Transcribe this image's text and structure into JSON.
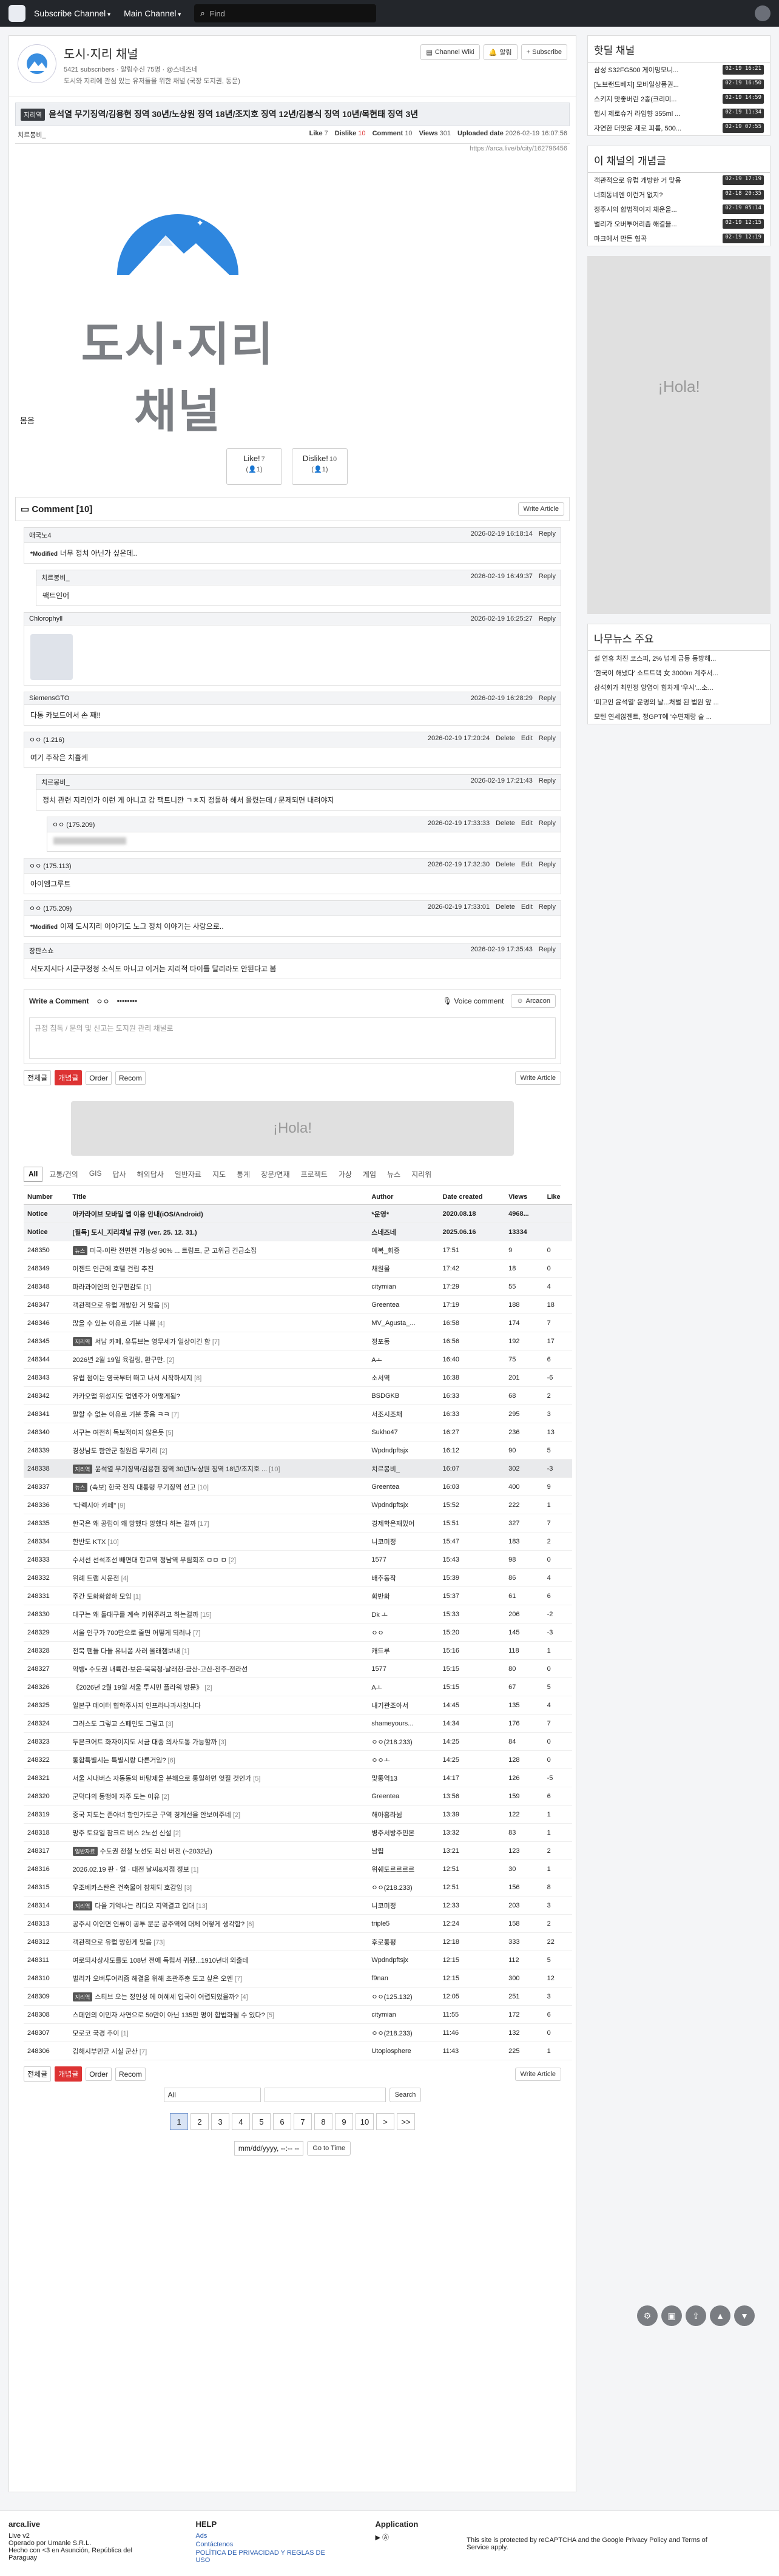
{
  "nav": {
    "subscribe": "Subscribe Channel",
    "main": "Main Channel",
    "search_placeholder": "Find"
  },
  "channel": {
    "name": "도시·지리 채널",
    "subs": "5421 subscribers",
    "alarm": "알림수신 75명",
    "owner": "@스네즈네",
    "desc": "도시와 지리에 관심 있는 유저들을 위한 채널 (국장 도지권, 동문)",
    "wiki": "Channel Wiki",
    "alarm_btn": "알림",
    "subscribe_btn": "+ Subscribe"
  },
  "article": {
    "tag": "지리역",
    "title": "윤석열 무기징역/김용현 징역 30년/노상원 징역 18년/조지호 징역 12년/김봉식 징역 10년/목현태 징역 3년",
    "author": "치르봉비_",
    "like": "7",
    "dislike": "10",
    "comment": "10",
    "views": "301",
    "uploaded": "2026-02-19 16:07:56",
    "url": "https://arca.live/b/city/162796456",
    "body_brand": "도시·지리 채널",
    "body_text": "몸음",
    "like_btn": "Like!",
    "like_n": "7",
    "like_u": "(👤1)",
    "dislike_btn": "Dislike!",
    "dislike_n": "10",
    "dislike_u": "(👤1)"
  },
  "labels": {
    "like": "Like",
    "dislike": "Dislike",
    "comment": "Comment",
    "views": "Views",
    "uploaded": "Uploaded date",
    "comment_title": "Comment [10]",
    "write_article": "Write Article",
    "reply": "Reply",
    "delete": "Delete",
    "edit": "Edit",
    "write_comment": "Write a Comment",
    "pw_dots": "••••••••",
    "voice": "Voice comment",
    "arcacon": "Arcacon",
    "textarea": "규정 침독 / 문의 및 신고는 도지원 관리 채널로",
    "all_list": "전체글",
    "hot": "개념글",
    "order": "Order",
    "recom": "Recom",
    "modified": "*Modified",
    "ad": "¡Hola!"
  },
  "comments": [
    {
      "name": "애국노4",
      "date": "2026-02-19 16:18:14",
      "text": "너무 정치 아닌가 싶은데..",
      "mod": true,
      "indent": 0,
      "own": false
    },
    {
      "name": "치르봉비_",
      "date": "2026-02-19 16:49:37",
      "text": "팩트인어",
      "mod": false,
      "indent": 1,
      "own": false
    },
    {
      "name": "Chlorophyll",
      "date": "2026-02-19 16:25:27",
      "text": "",
      "mod": false,
      "indent": 0,
      "own": false,
      "avatar": true
    },
    {
      "name": "SiemensGTO",
      "date": "2026-02-19 16:28:29",
      "text": "다통 카보드에서 손 째!!",
      "mod": false,
      "indent": 0,
      "own": false
    },
    {
      "name": "ㅇㅇ (1.216)",
      "date": "2026-02-19 17:20:24",
      "text": "여기 주작은 치흘케",
      "mod": false,
      "indent": 0,
      "own": true
    },
    {
      "name": "치르봉비_",
      "date": "2026-02-19 17:21:43",
      "text": "정치 관련 지리인가 이런 게 아니고 감 팩트니깐 ㄱㅊ지 정몰하 해서 올렸는데 / 문제되면 내려야지",
      "mod": false,
      "indent": 1,
      "own": false
    },
    {
      "name": "ㅇㅇ (175.209)",
      "date": "2026-02-19 17:33:33",
      "text": "",
      "mod": false,
      "indent": 2,
      "own": true,
      "blur": true
    },
    {
      "name": "ㅇㅇ (175.113)",
      "date": "2026-02-19 17:32:30",
      "text": "아이엠그루트",
      "mod": false,
      "indent": 0,
      "own": true
    },
    {
      "name": "ㅇㅇ (175.209)",
      "date": "2026-02-19 17:33:01",
      "text": "이제 도시지리 이야기도 노그 정치 이야기는 사랑으로..",
      "mod": true,
      "indent": 0,
      "own": true
    },
    {
      "name": "장판스쇼",
      "date": "2026-02-19 17:35:43",
      "text": "서도지시다 시군구정청 소식도 아니고 이거는 지리적 타이틀 달리라도 안된다고 봄",
      "mod": false,
      "indent": 0,
      "own": false
    }
  ],
  "comment_user": "ㅇㅇ",
  "categories": [
    "All",
    "교통/건의",
    "GIS",
    "답사",
    "해외답사",
    "일반자료",
    "지도",
    "통계",
    "장문/연재",
    "프로젝트",
    "가상",
    "게임",
    "뉴스",
    "지리위"
  ],
  "table_headers": {
    "no": "Number",
    "title": "Title",
    "author": "Author",
    "date": "Date created",
    "views": "Views",
    "like": "Like"
  },
  "posts": [
    {
      "no": "Notice",
      "tag": "",
      "title": "아카라이브 모바일 앱 이용 안내(iOS/Android)",
      "cc": "",
      "author": "*운영*",
      "date": "2020.08.18",
      "views": "4968...",
      "like": "",
      "type": "notice"
    },
    {
      "no": "Notice",
      "tag": "",
      "title": "[필독] 도시_지리채널 규정 (ver. 25. 12. 31.)",
      "cc": "",
      "author": "스네즈네",
      "date": "2025.06.16",
      "views": "13334",
      "like": "",
      "type": "notice"
    },
    {
      "no": "248350",
      "tag": "뉴스",
      "title": "미국-이란 전면전 가능성 90% ... 트럼프, 군 고위급 긴급소집",
      "cc": "",
      "author": "예복_회증",
      "date": "17:51",
      "views": "9",
      "like": "0"
    },
    {
      "no": "248349",
      "tag": "",
      "title": "이젠드 인근에 호텔 건립 추진",
      "cc": "",
      "author": "채원물",
      "date": "17:42",
      "views": "18",
      "like": "0"
    },
    {
      "no": "248348",
      "tag": "",
      "title": "파라과이인의 인구편감도",
      "cc": "[1]",
      "author": "citymian",
      "date": "17:29",
      "views": "55",
      "like": "4"
    },
    {
      "no": "248347",
      "tag": "",
      "title": "객관적으로 유럽 개방한 거 맞음",
      "cc": "[5]",
      "author": "Greentea",
      "date": "17:19",
      "views": "188",
      "like": "18"
    },
    {
      "no": "248346",
      "tag": "",
      "title": "많을 수 있는 이유로 기분 나쁨",
      "cc": "[4]",
      "author": "MV_Agusta_...",
      "date": "16:58",
      "views": "174",
      "like": "7"
    },
    {
      "no": "248345",
      "tag": "지리역",
      "title": "서남 카페, 유튜브는 영무세가 일상이긴 함",
      "cc": "[7]",
      "author": "정포동",
      "date": "16:56",
      "views": "192",
      "like": "17"
    },
    {
      "no": "248344",
      "tag": "",
      "title": "2026년 2월 19일 육길링, 환구만.",
      "cc": "[2]",
      "author": "Aㅗ",
      "date": "16:40",
      "views": "75",
      "like": "6"
    },
    {
      "no": "248343",
      "tag": "",
      "title": "유럽 점이는 영국부터 떠고 나서 시작하시지",
      "cc": "[8]",
      "author": "소서역",
      "date": "16:38",
      "views": "201",
      "like": "-6"
    },
    {
      "no": "248342",
      "tag": "",
      "title": "카카오맵 위성지도 업엔주가 어떻게됨?",
      "cc": "",
      "author": "BSDGKB",
      "date": "16:33",
      "views": "68",
      "like": "2"
    },
    {
      "no": "248341",
      "tag": "",
      "title": "말할 수 없는 이유로 기분 좋음 ㅋㅋ",
      "cc": "[7]",
      "author": "서조시조채",
      "date": "16:33",
      "views": "295",
      "like": "3"
    },
    {
      "no": "248340",
      "tag": "",
      "title": "서구는 여전히 독보적이지 않은듯",
      "cc": "[5]",
      "author": "Sukho47",
      "date": "16:27",
      "views": "236",
      "like": "13"
    },
    {
      "no": "248339",
      "tag": "",
      "title": "경상남도 함안군 칠원읍 무기리",
      "cc": "[2]",
      "author": "Wpdndpftsjx",
      "date": "16:12",
      "views": "90",
      "like": "5"
    },
    {
      "no": "248338",
      "tag": "지리역",
      "title": "윤석열 무기징역/김용현 징역 30년/노상원 징역 18년/조지호 ...",
      "cc": "[10]",
      "author": "치르봉비_",
      "date": "16:07",
      "views": "302",
      "like": "-3",
      "type": "cur"
    },
    {
      "no": "248337",
      "tag": "뉴스",
      "title": "(속보) 한국 전직 대통령 무기징역 선고",
      "cc": "[10]",
      "author": "Greentea",
      "date": "16:03",
      "views": "400",
      "like": "9"
    },
    {
      "no": "248336",
      "tag": "",
      "title": "\"다렉시아 카페\"",
      "cc": "[9]",
      "author": "Wpdndpftsjx",
      "date": "15:52",
      "views": "222",
      "like": "1"
    },
    {
      "no": "248335",
      "tag": "",
      "title": "한국은 왜 공립이 왜 망했다 망했다 하는 걸까",
      "cc": "[17]",
      "author": "경제학은재밌어",
      "date": "15:51",
      "views": "327",
      "like": "7"
    },
    {
      "no": "248334",
      "tag": "",
      "title": "한반도 KTX",
      "cc": "[10]",
      "author": "니코미정",
      "date": "15:47",
      "views": "183",
      "like": "2"
    },
    {
      "no": "248333",
      "tag": "",
      "title": "수서선 선석조선 빼면대 한교역 정남역 무림회조 ㅁㅁ ㅁ",
      "cc": "[2]",
      "author": "1577",
      "date": "15:43",
      "views": "98",
      "like": "0"
    },
    {
      "no": "248332",
      "tag": "",
      "title": "위례 트램 시운전",
      "cc": "[4]",
      "author": "배추동작",
      "date": "15:39",
      "views": "86",
      "like": "4"
    },
    {
      "no": "248331",
      "tag": "",
      "title": "주간 도화화합하 모임",
      "cc": "[1]",
      "author": "화반화",
      "date": "15:37",
      "views": "61",
      "like": "6"
    },
    {
      "no": "248330",
      "tag": "",
      "title": "대구는 왜 돌대구를 계속 키워주려고 하는걸까",
      "cc": "[15]",
      "author": "Dk ㅗ",
      "date": "15:33",
      "views": "206",
      "like": "-2"
    },
    {
      "no": "248329",
      "tag": "",
      "title": "서울 인구가 700만으로 줄면 어떻게 되려나",
      "cc": "[7]",
      "author": "ㅇㅇ",
      "date": "15:20",
      "views": "145",
      "like": "-3"
    },
    {
      "no": "248328",
      "tag": "",
      "title": "전북 팬들 다들 유니폼 사러 올래챔보내",
      "cc": "[1]",
      "author": "캐드루",
      "date": "15:16",
      "views": "118",
      "like": "1"
    },
    {
      "no": "248327",
      "tag": "",
      "title": "약뱅• 수도권 내륙컨-보은-복복청-날래천-금산-고산-전주-전라선",
      "cc": "",
      "author": "1577",
      "date": "15:15",
      "views": "80",
      "like": "0"
    },
    {
      "no": "248326",
      "tag": "",
      "title": "《2026년 2월 19일 서울 투시민 플라워 방문》",
      "cc": "[2]",
      "author": "Aㅗ",
      "date": "15:15",
      "views": "67",
      "like": "5"
    },
    {
      "no": "248325",
      "tag": "",
      "title": "일본구 데이터 협학주사지 인프라나과사참니다",
      "cc": "",
      "author": "내기관조아서",
      "date": "14:45",
      "views": "135",
      "like": "4"
    },
    {
      "no": "248324",
      "tag": "",
      "title": "그러스도 그렇고 스페인도 그렇고",
      "cc": "[3]",
      "author": "shameyours...",
      "date": "14:34",
      "views": "176",
      "like": "7"
    },
    {
      "no": "248323",
      "tag": "",
      "title": "두븐크어트 화자이지도 서금 대중 의사도통 가능할까",
      "cc": "[3]",
      "author": "ㅇㅇ(218.233)",
      "date": "14:25",
      "views": "84",
      "like": "0"
    },
    {
      "no": "248322",
      "tag": "",
      "title": "통합특별시는 특별시랑 다른거임?",
      "cc": "[6]",
      "author": "ㅇㅇㅗ",
      "date": "14:25",
      "views": "128",
      "like": "0"
    },
    {
      "no": "248321",
      "tag": "",
      "title": "서울 시내버스 자동동의 바탕제을 분해으로 통일하면 엇질 것인가",
      "cc": "[5]",
      "author": "맞통역13",
      "date": "14:17",
      "views": "126",
      "like": "-5"
    },
    {
      "no": "248320",
      "tag": "",
      "title": "군덕다의 동맹에 자주 도는 이유",
      "cc": "[2]",
      "author": "Greentea",
      "date": "13:56",
      "views": "159",
      "like": "6"
    },
    {
      "no": "248319",
      "tag": "",
      "title": "중국 지도는 존아너 항인가도군 구역 경계선을 안보여주네",
      "cc": "[2]",
      "author": "해아홍라뉨",
      "date": "13:39",
      "views": "122",
      "like": "1"
    },
    {
      "no": "248318",
      "tag": "",
      "title": "망주 토요일 참크르 버스 2노선 신설",
      "cc": "[2]",
      "author": "병주서방주민본",
      "date": "13:32",
      "views": "83",
      "like": "1"
    },
    {
      "no": "248317",
      "tag": "일반자료",
      "title": "수도권 전철 노선도 최신 버전 (~2032년)",
      "cc": "",
      "author": "남렵",
      "date": "13:21",
      "views": "123",
      "like": "2"
    },
    {
      "no": "248316",
      "tag": "",
      "title": "2026.02.19 판 · 얼 · 대전 날씨&지점 정보",
      "cc": "[1]",
      "author": "위쉐도르르르르",
      "date": "12:51",
      "views": "30",
      "like": "1"
    },
    {
      "no": "248315",
      "tag": "",
      "title": "우조베카스탄은 건축물이 참체되 호감임",
      "cc": "[3]",
      "author": "ㅇㅇ(218.233)",
      "date": "12:51",
      "views": "156",
      "like": "8"
    },
    {
      "no": "248314",
      "tag": "지리역",
      "title": "다을 기억나는 리디오 지역결고 입대",
      "cc": "[13]",
      "author": "니코미정",
      "date": "12:33",
      "views": "203",
      "like": "3"
    },
    {
      "no": "248313",
      "tag": "",
      "title": "공주시 이인면 인류이 공투 분문 공주역에 대체 어떻게 생각함?",
      "cc": "[6]",
      "author": "triple5",
      "date": "12:24",
      "views": "158",
      "like": "2"
    },
    {
      "no": "248312",
      "tag": "",
      "title": "객관적으로 유럽 망한게 맞음",
      "cc": "[73]",
      "author": "후로통평",
      "date": "12:18",
      "views": "333",
      "like": "22"
    },
    {
      "no": "248311",
      "tag": "",
      "title": "여로되사상사도를도 108년 전에 독립서 귀됐...1910년대 외출테",
      "cc": "",
      "author": "Wpdndpftsjx",
      "date": "12:15",
      "views": "112",
      "like": "5"
    },
    {
      "no": "248310",
      "tag": "",
      "title": "벌리가 오버투어리즘 해결을 위해 초관주충 도고 싶은 오엔",
      "cc": "[7]",
      "author": "f9nan",
      "date": "12:15",
      "views": "300",
      "like": "12"
    },
    {
      "no": "248309",
      "tag": "지리역",
      "title": "스티브 오는 정인성 에 여혜세 입국이 어렵되었을까?",
      "cc": "[4]",
      "author": "ㅇㅇ(125.132)",
      "date": "12:05",
      "views": "251",
      "like": "3"
    },
    {
      "no": "248308",
      "tag": "",
      "title": "스페인의 이민자 사연으로 50만이 아닌 135만 명이 합법화될 수 있다?",
      "cc": "[5]",
      "author": "citymian",
      "date": "11:55",
      "views": "172",
      "like": "6"
    },
    {
      "no": "248307",
      "tag": "",
      "title": "모로코 국경 추이",
      "cc": "[1]",
      "author": "ㅇㅇ(218.233)",
      "date": "11:46",
      "views": "132",
      "like": "0"
    },
    {
      "no": "248306",
      "tag": "",
      "title": "김해시부민균 시실 군산",
      "cc": "[7]",
      "author": "Utopiosphere",
      "date": "11:43",
      "views": "225",
      "like": "1"
    }
  ],
  "pager": [
    "1",
    "2",
    "3",
    "4",
    "5",
    "6",
    "7",
    "8",
    "9",
    "10",
    ">",
    ">>"
  ],
  "search": {
    "scope": "All",
    "btn": "Search",
    "date_placeholder": "mm/dd/yyyy, --:-- --",
    "go": "Go to Time"
  },
  "footer": {
    "brand": "arca.live",
    "ver": "Live v2",
    "company": "Operado por Umanle S.R.L.",
    "made": "Hecho con <3 en Asunción, República del Paraguay",
    "help": "HELP",
    "ads": "Ads",
    "contact": "Contáctenos",
    "policy": "POLÍTICA DE PRIVACIDAD Y REGLAS DE USO",
    "app": "Application",
    "recaptcha": "This site is protected by reCAPTCHA and the Google Privacy Policy and Terms of Service apply."
  },
  "side": {
    "hot_title": "핫딜 채널",
    "hot": [
      {
        "t": "삼성 S32FG500 게이밍모니...",
        "tm": "02-19 16:21"
      },
      {
        "t": "[노브랜드베지] 모바일상품권...",
        "tm": "02-19 16:50"
      },
      {
        "t": "스키지 맛좋버린 2종(크리미...",
        "tm": "02-19 14:59"
      },
      {
        "t": "햅시 제로슈거 라임향 355ml ...",
        "tm": "02-19 11:34"
      },
      {
        "t": "자연한 더맛운 제로 피룸, 500...",
        "tm": "02-19 07:55"
      }
    ],
    "best_title": "이 채널의 개념글",
    "best": [
      {
        "t": "객관적으로 유럽 개방한 거 맞음",
        "tm": "02-19 17:19"
      },
      {
        "t": "너희동네엔 이런거 없지?",
        "tm": "02-18 20:35"
      },
      {
        "t": "정주시의 합법적이지 채운을...",
        "tm": "02-19 05:14"
      },
      {
        "t": "벌리가 오버투어리즘 해결을...",
        "tm": "02-19 12:15"
      },
      {
        "t": "마크에서 만든 협곡",
        "tm": "02-19 12:19"
      }
    ],
    "news_title": "나무뉴스 주요",
    "news": [
      "설 연휴 처진 코스피, 2% 넘게 급등 동방해...",
      "'한국이 해냈다' 쇼트트랙 女 3000m 계주서...",
      "삼석회가 최민정 앙엽이 힘차게 '우시'...소...",
      "'피고인 윤석열' 운명의 날...처벌 된 법원 앞 ...",
      "모텐 연세않젠트, 정GPT에 '수면제랑 술 ..."
    ]
  }
}
